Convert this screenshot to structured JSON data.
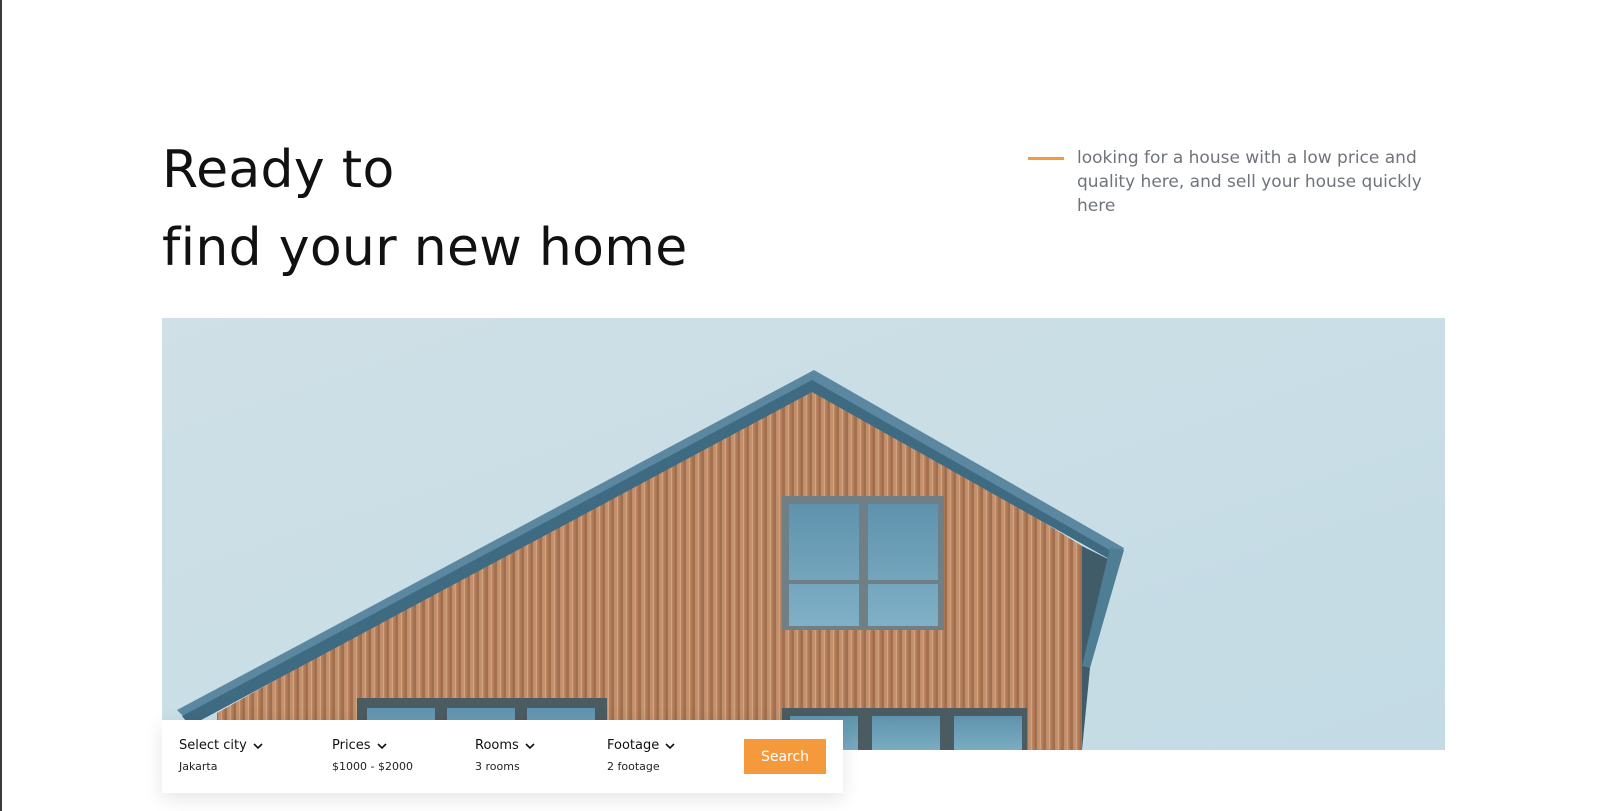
{
  "hero": {
    "title_line1": "Ready to",
    "title_line2": "find your new home",
    "tagline": "looking for a house with a low price and quality here, and sell your house quickly here"
  },
  "search": {
    "filters": [
      {
        "label": "Select city",
        "value": "Jakarta",
        "icon": "chevron-down-icon"
      },
      {
        "label": "Prices",
        "value": "$1000 - $2000",
        "icon": "chevron-down-icon"
      },
      {
        "label": "Rooms",
        "value": "3 rooms",
        "icon": "chevron-down-icon"
      },
      {
        "label": "Footage",
        "value": "2 footage",
        "icon": "chevron-down-icon"
      }
    ],
    "button_label": "Search"
  },
  "colors": {
    "accent": "#f59a3c",
    "title": "#111111",
    "muted_text": "#6f747c",
    "sky": "#c6dde6"
  }
}
